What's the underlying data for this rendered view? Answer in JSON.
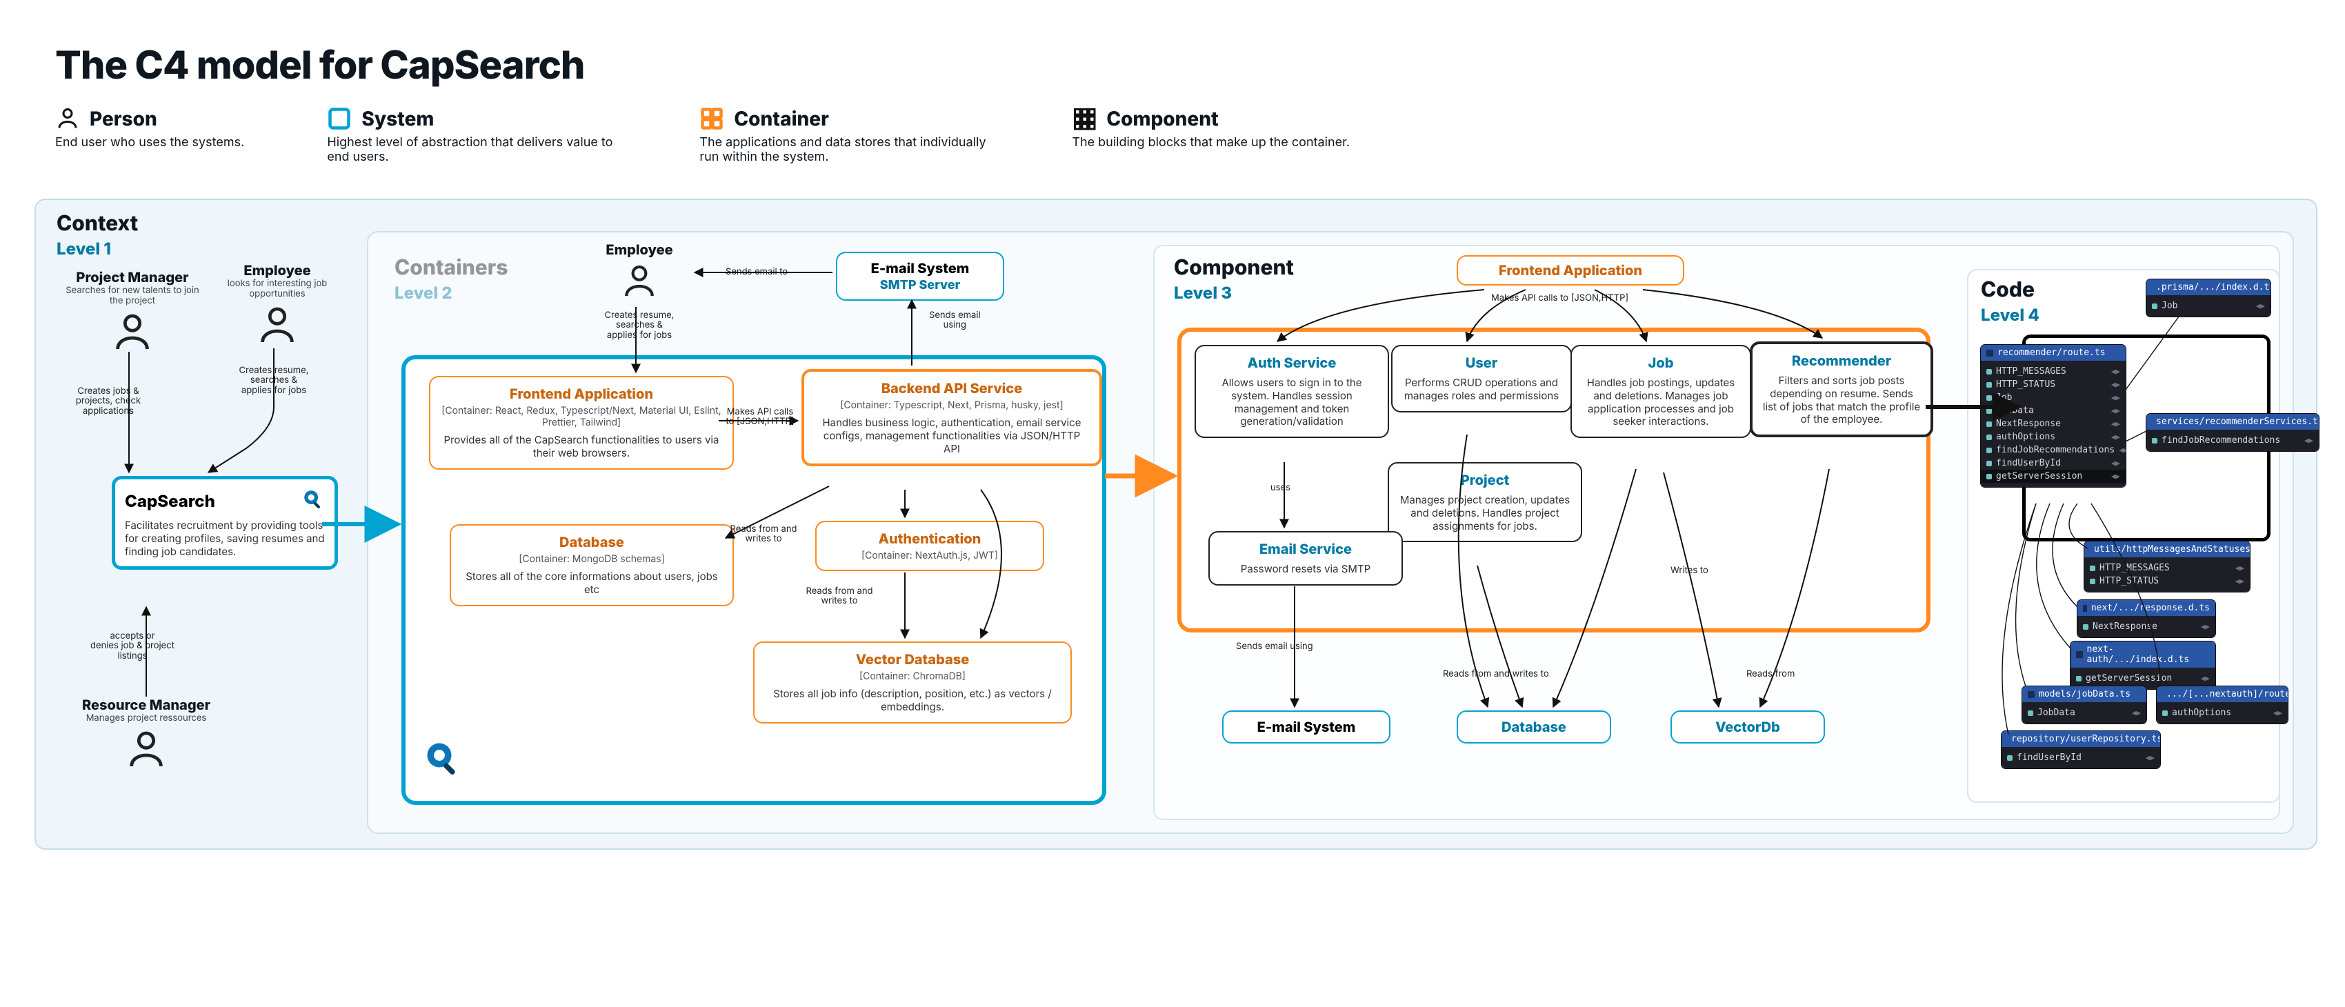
{
  "title": "The C4 model for CapSearch",
  "legend": {
    "person": {
      "label": "Person",
      "desc": "End user who uses the systems."
    },
    "system": {
      "label": "System",
      "desc": "Highest level of abstraction that delivers value to end users."
    },
    "container": {
      "label": "Container",
      "desc": "The applications and data stores that individually run within the system."
    },
    "component": {
      "label": "Component",
      "desc": "The building blocks that make up the container."
    }
  },
  "context": {
    "heading": "Context",
    "level": "Level 1",
    "persons": {
      "project_manager": {
        "title": "Project Manager",
        "desc": "Searches for new talents to join the project"
      },
      "employee": {
        "title": "Employee",
        "desc": "looks for interesting job opportunities"
      },
      "resource_manager": {
        "title": "Resource Manager",
        "desc": "Manages project ressources"
      }
    },
    "system": {
      "title": "CapSearch",
      "desc": "Facilitates recruitment by providing tools for creating profiles, saving resumes and finding job candidates."
    },
    "edges": {
      "pm": "Creates jobs &\nprojects, check\napplications",
      "emp": "Creates resume,\nsearches &\napplies for jobs",
      "rm": "accepts or\ndenies job & project\nlistings"
    }
  },
  "containers": {
    "heading": "Containers",
    "level": "Level 2",
    "employee": {
      "title": "Employee"
    },
    "employee_note": "Creates resume,\nsearches &\napplies for jobs",
    "email_sys": {
      "title": "E-mail System",
      "sub": "SMTP Server"
    },
    "email_note_left": "Sends email to",
    "email_note_down": "Sends email\nusing",
    "frontend": {
      "title": "Frontend Application",
      "tech": "[Container: React, Redux, Typescript/Next, Material UI, Eslint, Prettier, Tailwind]",
      "desc": "Provides all of the CapSearch functionalities to users via their web browsers."
    },
    "backend": {
      "title": "Backend API Service",
      "tech": "[Container: Typescript, Next, Prisma, husky, jest]",
      "desc": "Handles business logic, authentication, email service configs, management functionalities via JSON/HTTP API"
    },
    "api_call_note": "Makes API calls\nto [JSON,HTTP]",
    "database": {
      "title": "Database",
      "tech": "[Container: MongoDB schemas]",
      "desc": "Stores all of the core informations about users, jobs etc"
    },
    "db_note": "Reads from and\nwrites to",
    "auth": {
      "title": "Authentication",
      "tech": "[Container: NextAuth.js, JWT]"
    },
    "auth_note": "Reads from and\nwrites to",
    "vector": {
      "title": "Vector Database",
      "tech": "[Container: ChromaDB]",
      "desc": "Stores all job info (description, position, etc.) as vectors / embeddings."
    }
  },
  "component": {
    "heading": "Component",
    "level": "Level 3",
    "front": {
      "title": "Frontend Application"
    },
    "front_note": "Makes API calls to [JSON,HTTP]",
    "auth": {
      "title": "Auth Service",
      "desc": "Allows users to sign in to the system. Handles session management and token generation/validation"
    },
    "user": {
      "title": "User",
      "desc": "Performs CRUD operations and manages roles and permissions"
    },
    "job": {
      "title": "Job",
      "desc": "Handles job postings, updates and deletions. Manages job application processes and job seeker interactions."
    },
    "recommender": {
      "title": "Recommender",
      "desc": "Filters and sorts job posts depending on resume. Sends list of jobs that match the profile of the employee."
    },
    "project": {
      "title": "Project",
      "desc": "Manages project creation, updates and deletions. Handles project assignments for jobs."
    },
    "email": {
      "title": "Email Service",
      "desc": "Password resets via SMTP"
    },
    "uses_note": "uses",
    "externals": {
      "email": {
        "title": "E-mail System"
      },
      "db": {
        "title": "Database"
      },
      "vector": {
        "title": "VectorDb"
      }
    },
    "send_note": "Sends email using",
    "rw_note": "Reads from and writes to",
    "writes_note": "Writes to",
    "reads_note": "Reads from"
  },
  "code": {
    "heading": "Code",
    "level": "Level 4",
    "panels": {
      "prisma": {
        "head": ".prisma/.../index.d.ts",
        "rows": [
          "Job"
        ]
      },
      "route": {
        "head": "recommender/route.ts",
        "rows": [
          "HTTP_MESSAGES",
          "HTTP_STATUS",
          "Job",
          "JobData",
          "NextResponse",
          "authOptions",
          "findJobRecommendations",
          "findUserById",
          "getServerSession"
        ]
      },
      "services": {
        "head": "services/recommenderServices.ts",
        "rows": [
          "findJobRecommendations"
        ]
      },
      "values": {
        "head": "utils/httpMessagesAndStatuses.ts",
        "rows": [
          "HTTP_MESSAGES",
          "HTTP_STATUS"
        ]
      },
      "response": {
        "head": "next/.../response.d.ts",
        "rows": [
          "NextResponse"
        ]
      },
      "nextauth": {
        "head": "next-auth/.../index.d.ts",
        "rows": [
          "getServerSession"
        ]
      },
      "models": {
        "head": "models/jobData.ts",
        "rows": [
          "JobData"
        ]
      },
      "authroute": {
        "head": ".../[...nextauth]/route.ts",
        "rows": [
          "authOptions"
        ]
      },
      "repo": {
        "head": "repository/userRepository.ts",
        "rows": [
          "findUserById"
        ]
      }
    }
  }
}
